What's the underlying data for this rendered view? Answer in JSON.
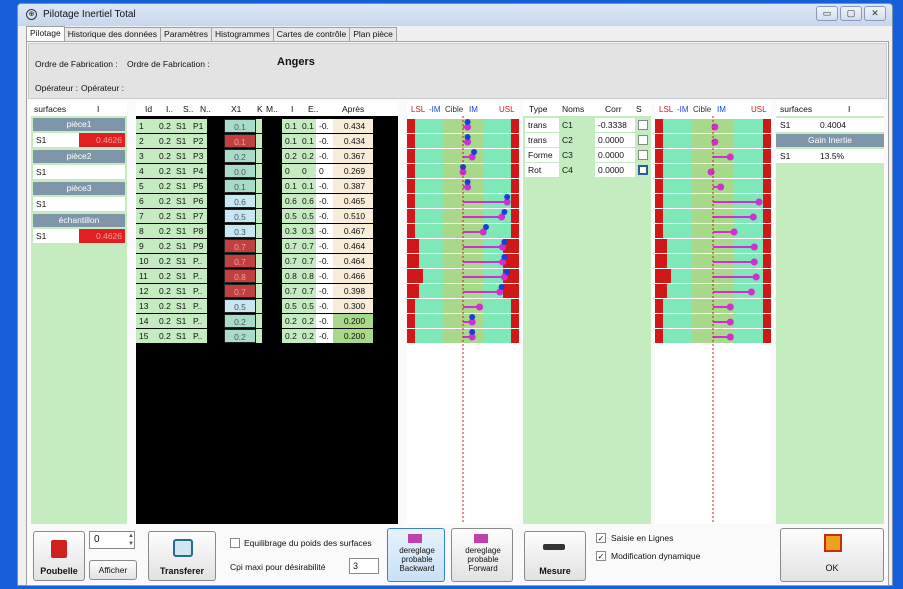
{
  "window": {
    "title": "Pilotage Inertiel Total",
    "icon": "app-icon",
    "controls": [
      "▭",
      "▢",
      "✕"
    ]
  },
  "tabs": [
    "Pilotage",
    "Historique des données",
    "Paramètres",
    "Histogrammes",
    "Cartes de contrôle",
    "Plan pièce"
  ],
  "header": {
    "of_label": "Ordre de Fabrication :",
    "of_label2": "Ordre de Fabrication :",
    "city": "Angers",
    "op_label": "Opérateur :",
    "op_label2": "Opérateur :"
  },
  "surfaces": {
    "headers": [
      "surfaces",
      "I"
    ],
    "groups": [
      {
        "name": "pièce1",
        "row": "S1",
        "value": "0.4626",
        "alert": true
      },
      {
        "name": "pièce2",
        "row": "S1",
        "value": "",
        "alert": false
      },
      {
        "name": "pièce3",
        "row": "S1",
        "value": "",
        "alert": false
      },
      {
        "name": "échantillon",
        "row": "S1",
        "value": "0.4626",
        "alert": true
      }
    ]
  },
  "table": {
    "headers": [
      "Id",
      "I..",
      "S..",
      "N..",
      "X1",
      "K",
      "M..",
      "I",
      "E..",
      "Après"
    ],
    "rows": [
      [
        "1",
        "0.2",
        "S1",
        "P1",
        "0.1",
        "0.1",
        "0.1",
        "-0.",
        "0.434"
      ],
      [
        "2",
        "0.2",
        "S1",
        "P2",
        "0.1",
        "0.1",
        "0.1",
        "-0.",
        "0.434"
      ],
      [
        "3",
        "0.2",
        "S1",
        "P3",
        "0.2",
        "0.2",
        "0.2",
        "-0.",
        "0.367"
      ],
      [
        "4",
        "0.2",
        "S1",
        "P4",
        "0.0",
        "0",
        "0",
        "0",
        "0.269"
      ],
      [
        "5",
        "0.2",
        "S1",
        "P5",
        "0.1",
        "0.1",
        "0.1",
        "-0.",
        "0.387"
      ],
      [
        "6",
        "0.2",
        "S1",
        "P6",
        "0.6",
        "0.6",
        "0.6",
        "-0.",
        "0.465"
      ],
      [
        "7",
        "0.2",
        "S1",
        "P7",
        "0.5",
        "0.5",
        "0.5",
        "-0.",
        "0.510"
      ],
      [
        "8",
        "0.2",
        "S1",
        "P8",
        "0.3",
        "0.3",
        "0.3",
        "-0.",
        "0.467"
      ],
      [
        "9",
        "0.2",
        "S1",
        "P9",
        "0.7",
        "0.7",
        "0.7",
        "-0.",
        "0.464"
      ],
      [
        "10",
        "0.2",
        "S1",
        "P..",
        "0.7",
        "0.7",
        "0.7",
        "-0.",
        "0.464"
      ],
      [
        "11",
        "0.2",
        "S1",
        "P..",
        "0.8",
        "0.8",
        "0.8",
        "-0.",
        "0.466"
      ],
      [
        "12",
        "0.2",
        "S1",
        "P..",
        "0.7",
        "0.7",
        "0.7",
        "-0.",
        "0.398"
      ],
      [
        "13",
        "0.2",
        "S1",
        "P..",
        "0.5",
        "0.5",
        "0.5",
        "-0.",
        "0.300"
      ],
      [
        "14",
        "0.2",
        "S1",
        "P..",
        "0.2",
        "0.2",
        "0.2",
        "-0.",
        "0.200"
      ],
      [
        "15",
        "0.2",
        "S1",
        "P..",
        "0.2",
        "0.2",
        "0.2",
        "-0.",
        "0.200"
      ]
    ],
    "x1_colors": [
      "#a8dcc8",
      "#c04040",
      "#a8dcc8",
      "#a8dcc8",
      "#a8dcc8",
      "#c9e7f2",
      "#c9e7f2",
      "#c9e7f2",
      "#c04040",
      "#c04040",
      "#c04040",
      "#c04040",
      "#c9e7f2",
      "#a8dcc8",
      "#a8dcc8"
    ],
    "after_colors": [
      "#f8edd8",
      "#f8edd8",
      "#f8edd8",
      "#f8edd8",
      "#f8edd8",
      "#f8edd8",
      "#f8edd8",
      "#f8edd8",
      "#f8edd8",
      "#f8edd8",
      "#f8edd8",
      "#f8edd8",
      "#f8edd8",
      "#a8d88a",
      "#a8d88a"
    ]
  },
  "chart1": {
    "labels": [
      "LSL",
      "-IM",
      "Cible",
      "IM",
      "USL"
    ],
    "red_width": [
      1,
      1,
      1,
      1,
      1,
      1,
      1,
      1,
      2,
      2,
      3,
      2,
      1,
      1,
      1
    ],
    "red_right": [
      1,
      1,
      1,
      1,
      1,
      1,
      1,
      1,
      3,
      3,
      3,
      3,
      1,
      1,
      1
    ],
    "pink": [
      0.55,
      0.55,
      0.6,
      0.5,
      0.55,
      0.98,
      0.92,
      0.72,
      0.93,
      0.93,
      0.95,
      0.9,
      0.68,
      0.6,
      0.6
    ],
    "blue": [
      0.55,
      0.55,
      0.62,
      0.5,
      0.55,
      0.98,
      0.95,
      0.75,
      0.95,
      0.95,
      0.98,
      0.92,
      null,
      0.6,
      0.6
    ]
  },
  "corr": {
    "headers": [
      "Type",
      "Noms",
      "Corr",
      "S"
    ],
    "rows": [
      [
        "trans",
        "C1",
        "-0.3338"
      ],
      [
        "trans",
        "C2",
        "0.0000"
      ],
      [
        "Forme",
        "C3",
        "0.0000"
      ],
      [
        "Rot",
        "C4",
        "0.0000"
      ]
    ]
  },
  "chart2": {
    "labels": [
      "LSL",
      "-IM",
      "Cible",
      "IM",
      "USL"
    ],
    "red_width": [
      1,
      1,
      1,
      1,
      1,
      1,
      1,
      1,
      2,
      2,
      3,
      2,
      1,
      1,
      1
    ],
    "pink": [
      0.52,
      0.52,
      0.68,
      0.48,
      0.58,
      0.98,
      0.92,
      0.72,
      0.93,
      0.93,
      0.95,
      0.9,
      0.68,
      0.68,
      0.68
    ]
  },
  "gain": {
    "headers": [
      "surfaces",
      "I"
    ],
    "row1": [
      "S1",
      "0.4004"
    ],
    "gain_label": "Gain Inertie",
    "row2": [
      "S1",
      "13.5%"
    ]
  },
  "bottom": {
    "poubelle": "Poubelle",
    "counter": "0",
    "afficher": "Afficher",
    "transferer": "Transferer",
    "equilibrage": "Equilibrage du poids des surfaces",
    "cpi_label": "Cpi maxi pour désirabilité",
    "cpi_value": "3",
    "backward": "dereglage probable Backward",
    "forward": "dereglage probable Forward",
    "mesure": "Mesure",
    "saisie": "Saisie en Lignes",
    "modif": "Modification dynamique",
    "ok": "OK"
  },
  "colors": {
    "green": "#c5ecc0",
    "seafoam": "#7fe8b8",
    "red": "#d01818",
    "magenta": "#d030d0",
    "blue": "#1840d8"
  }
}
